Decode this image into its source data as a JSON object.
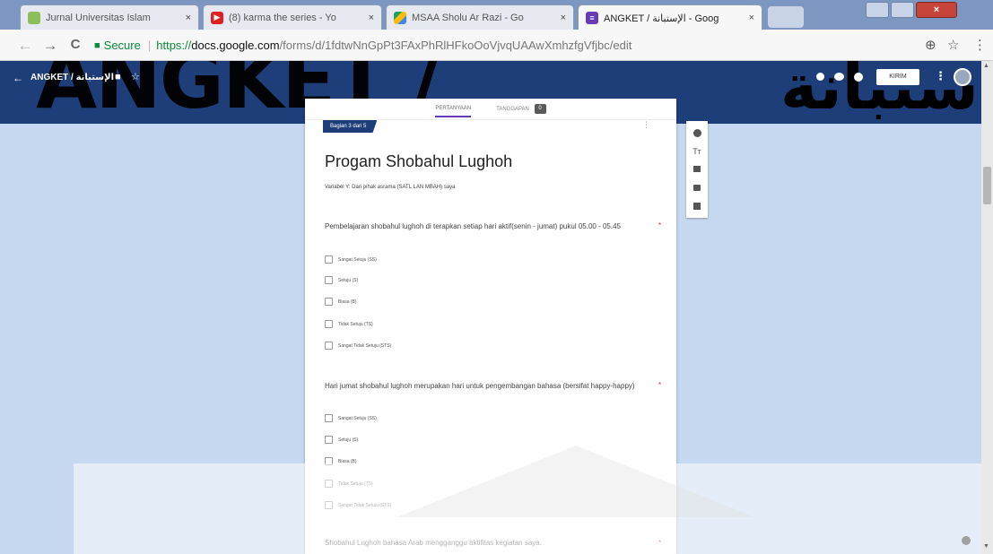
{
  "browser": {
    "tabs": [
      {
        "title": "Jurnal Universitas Islam",
        "favicon": "globe-icon"
      },
      {
        "title": "(8) karma the series - Yo",
        "favicon": "youtube-icon"
      },
      {
        "title": "MSAA Sholu Ar Razi - Go",
        "favicon": "drive-icon"
      },
      {
        "title": "ANGKET / الإستبانة - Goog",
        "favicon": "forms-icon"
      }
    ],
    "tab_close": "×",
    "secure_label": "Secure",
    "url_proto": "https://",
    "url_host": "docs.google.com",
    "url_path": "/forms/d/1fdtwNnGpPt3FAxPhRlHFkoOoVjvqUAAwXmhzfgVfjbc/edit",
    "back_glyph": "←",
    "forward_glyph": "→",
    "reload_glyph": "C"
  },
  "forms_header": {
    "form_name": "ANGKET / الإستبانة",
    "graphic_text_left": "ANGKET /",
    "graphic_text_right": "إستبانة",
    "send_label": "KIRIM"
  },
  "form": {
    "tabs": {
      "questions": "PERTANYAAN",
      "responses": "TANGGAPAN",
      "responses_count": "0"
    },
    "section_tag": "Bagian 3 dari 5",
    "section_title": "Progam Shobahul Lughoh",
    "section_desc": "Variabel Y: Dari pihak asrama (SATL LAN MBAH) saya",
    "questions": [
      {
        "title": "Pembelajaran shobahul lughoh di terapkan setiap hari aktif(senin - jumat) pukul 05.00 - 05.45",
        "required": "*",
        "options": [
          "Sangat Setuju (SS)",
          "Setuju (S)",
          "Biasa (B)",
          "Tidak Setuju (TS)",
          "Sangat Tidak Setuju (STS)"
        ]
      },
      {
        "title": "Hari jumat shobahul lughoh merupakan hari untuk pengembangan bahasa (bersifat happy-happy)",
        "required": "*",
        "options": [
          "Sangat Setuju (SS)",
          "Setuju (S)",
          "Biasa (B)",
          "Tidak Setuju (TS)",
          "Sangat Tidak Setuju (STS)"
        ]
      },
      {
        "title": "Shobahul Lughoh bahasa Arab mengganggu aktifitas kegiatan saya.",
        "required": "*"
      }
    ]
  },
  "colors": {
    "header_bg": "#1e3e7a",
    "page_bg": "#c6d9f0",
    "accent": "#673ab7",
    "required": "#d93025"
  }
}
